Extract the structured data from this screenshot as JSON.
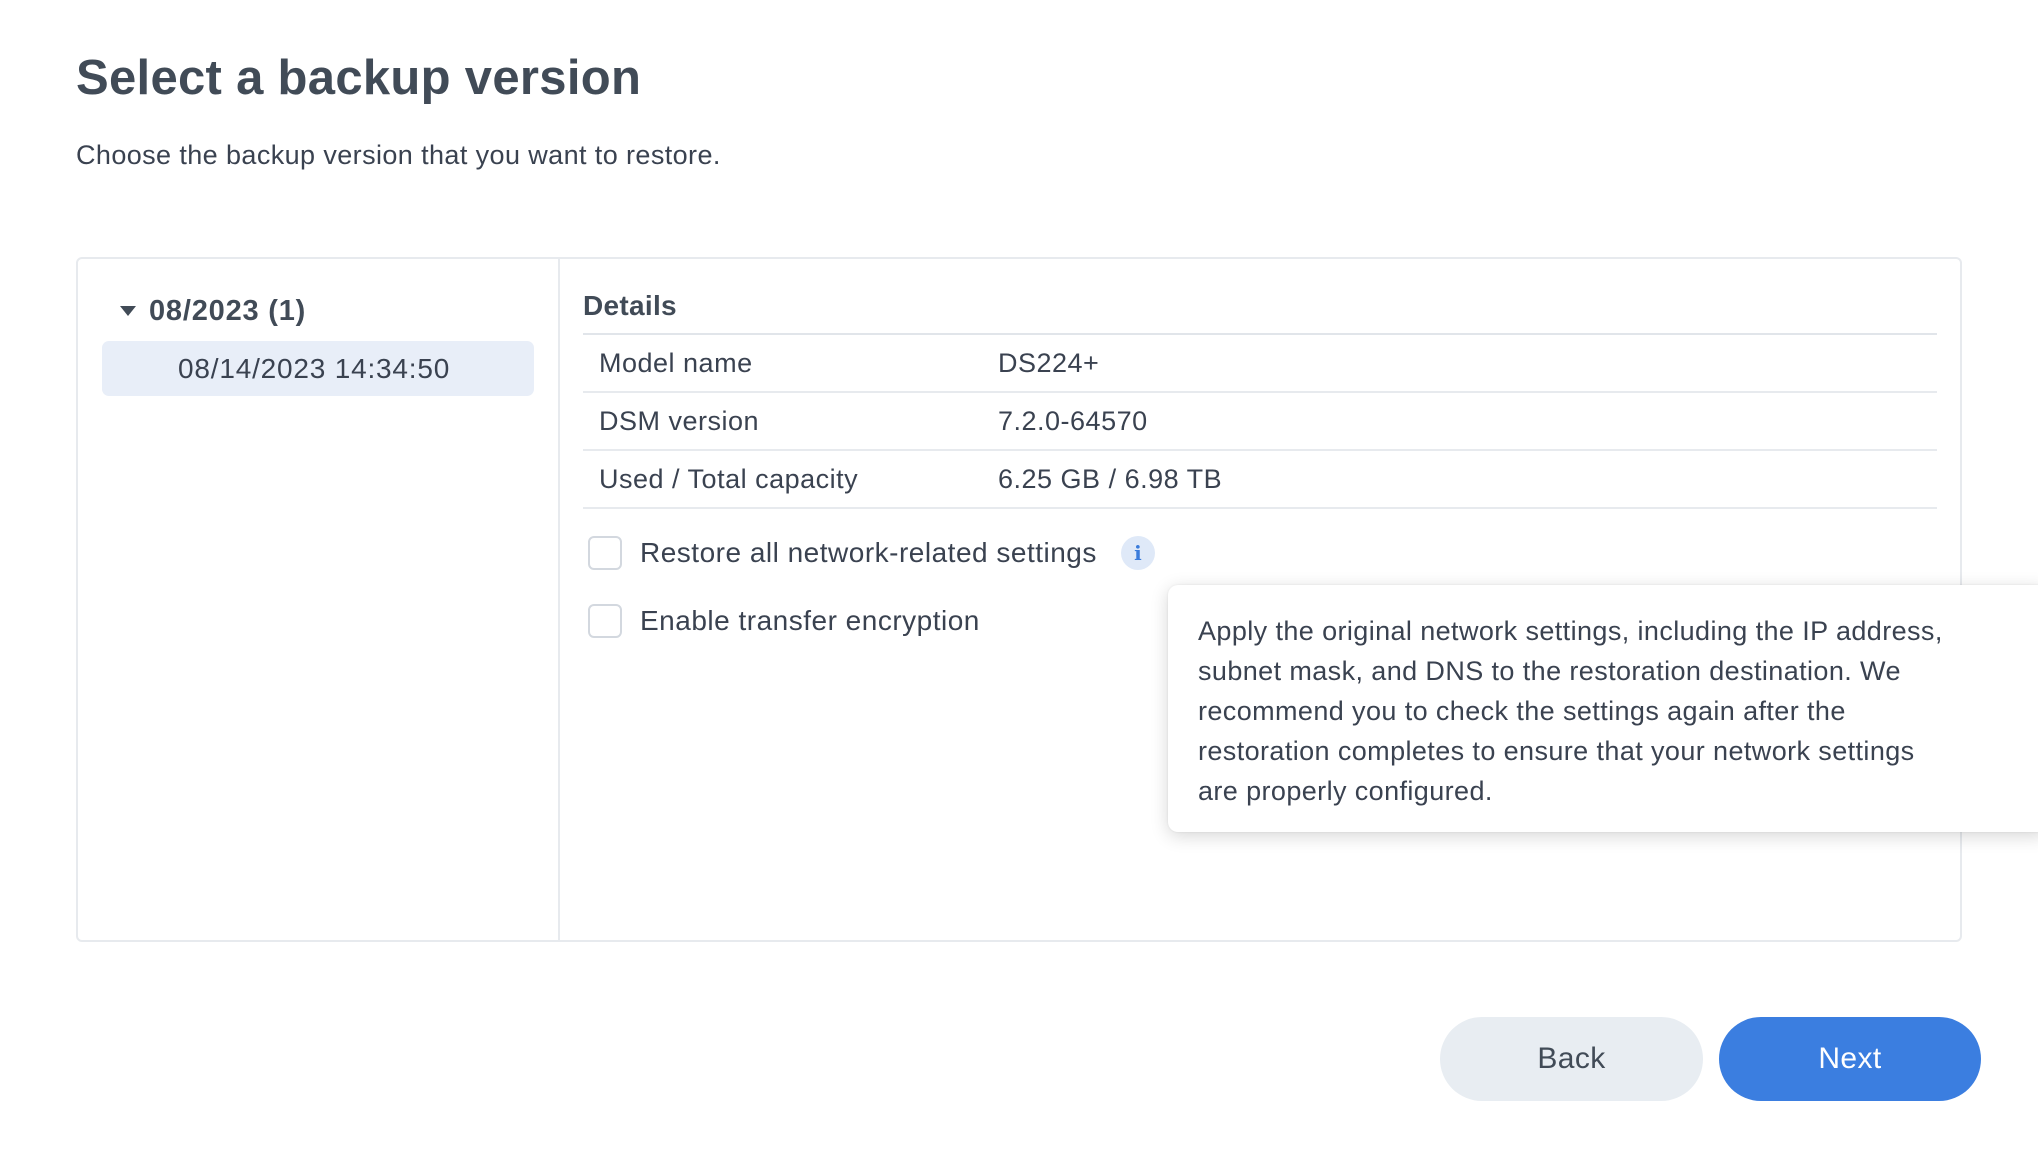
{
  "header": {
    "title": "Select a backup version",
    "subtitle": "Choose the backup version that you want to restore."
  },
  "versions": {
    "group_label": "08/2023 (1)",
    "items": [
      "08/14/2023 14:34:50"
    ],
    "selected_index": 0
  },
  "details": {
    "title": "Details",
    "rows": [
      {
        "key": "Model name",
        "value": "DS224+"
      },
      {
        "key": "DSM version",
        "value": "7.2.0-64570"
      },
      {
        "key": "Used / Total capacity",
        "value": "6.25 GB / 6.98 TB"
      }
    ]
  },
  "options": {
    "restore_network": {
      "label": "Restore all network-related settings",
      "checked": false
    },
    "transfer_encryption": {
      "label": "Enable transfer encryption",
      "checked": false
    },
    "info_icon_glyph": "i"
  },
  "tooltip": {
    "lines": [
      "Apply the original network settings, including the IP address,",
      "subnet mask, and DNS to the restoration destination. We",
      "recommend you to check the settings again after the",
      "restoration completes to ensure that your network settings",
      "are properly configured."
    ]
  },
  "footer": {
    "back_label": "Back",
    "next_label": "Next"
  },
  "colors": {
    "accent": "#3b7ee0",
    "selected_bg": "#e8eef8",
    "secondary_button_bg": "#e8edf2"
  }
}
